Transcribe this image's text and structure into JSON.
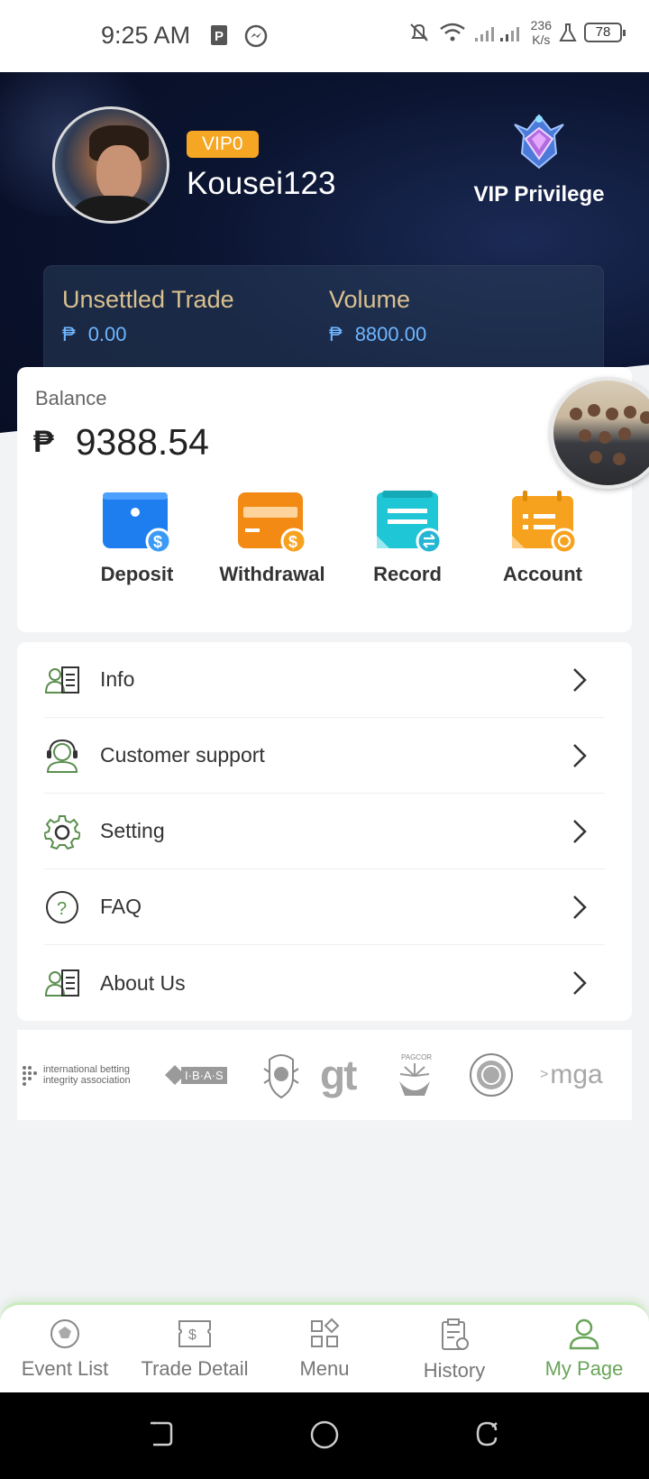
{
  "status_bar": {
    "time": "9:25 AM",
    "speed_value": "236",
    "speed_unit": "K/s",
    "battery": "78"
  },
  "profile": {
    "vip_level": "VIP0",
    "username": "Kousei123",
    "vip_privilege_label": "VIP Privilege"
  },
  "trade_summary": {
    "currency_symbol": "₱",
    "unsettled_label": "Unsettled Trade",
    "unsettled_value": "0.00",
    "volume_label": "Volume",
    "volume_value": "8800.00"
  },
  "balance": {
    "label": "Balance",
    "currency_symbol": "₱",
    "value": "9388.54"
  },
  "actions": [
    {
      "label": "Deposit",
      "icon": "wallet-icon",
      "color": "#1e7ef0"
    },
    {
      "label": "Withdrawal",
      "icon": "card-icon",
      "color": "#f28a14"
    },
    {
      "label": "Record",
      "icon": "record-icon",
      "color": "#1fc6d6"
    },
    {
      "label": "Account",
      "icon": "account-icon",
      "color": "#f7a21e"
    }
  ],
  "menu": [
    {
      "label": "Info",
      "icon": "info-card-icon"
    },
    {
      "label": "Customer support",
      "icon": "headset-icon"
    },
    {
      "label": "Setting",
      "icon": "gear-icon"
    },
    {
      "label": "FAQ",
      "icon": "question-icon"
    },
    {
      "label": "About Us",
      "icon": "about-card-icon"
    }
  ],
  "partner_logos": {
    "ibia_line1": "international betting",
    "ibia_line2": "integrity association",
    "ibas": "I·B·A·S",
    "gt": "gt",
    "pagcor": "PAGCOR",
    "mga": "mga"
  },
  "bottom_nav": [
    {
      "label": "Event List",
      "icon": "ball-icon",
      "active": false
    },
    {
      "label": "Trade Detail",
      "icon": "ticket-icon",
      "active": false
    },
    {
      "label": "Menu",
      "icon": "menu-grid-icon",
      "active": false
    },
    {
      "label": "History",
      "icon": "history-icon",
      "active": false
    },
    {
      "label": "My Page",
      "icon": "user-icon",
      "active": true
    }
  ],
  "colors": {
    "accent_green": "#6aa55a",
    "vip_orange": "#f5a623",
    "header_navy": "#0b1430",
    "value_blue": "#6fb6ff"
  }
}
